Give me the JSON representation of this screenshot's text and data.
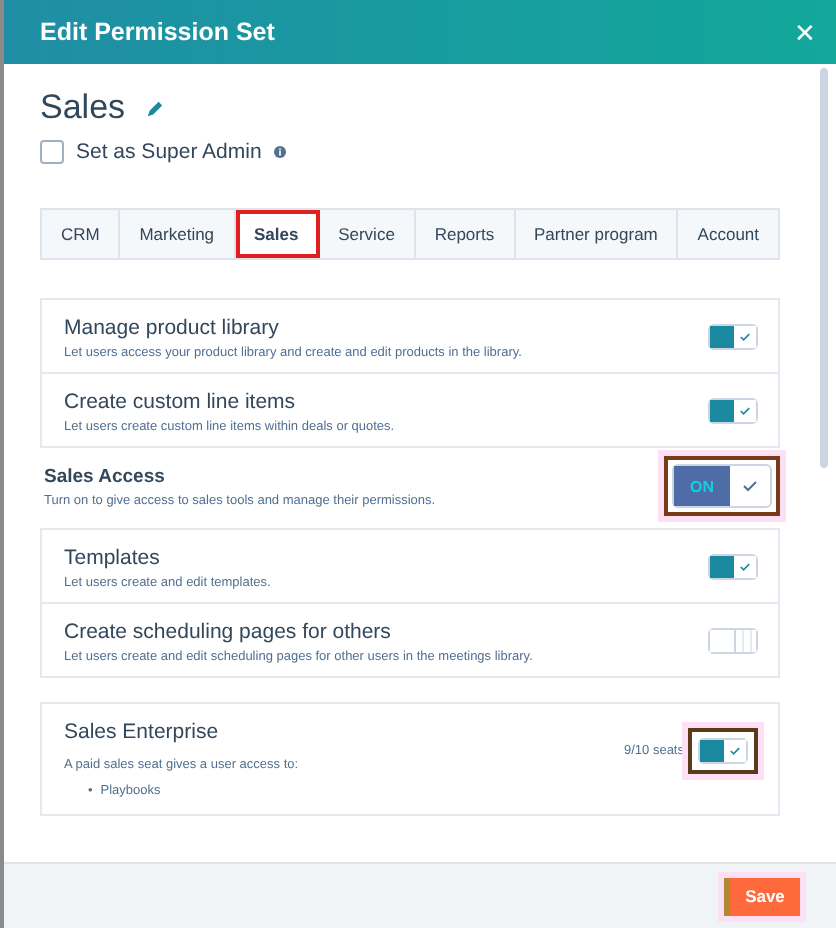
{
  "window": {
    "title": "Edit Permission Set",
    "close": "✕"
  },
  "permission_set": {
    "name": "Sales",
    "super_admin": {
      "label": "Set as Super Admin",
      "checked": false
    }
  },
  "tabs": [
    {
      "label": "CRM",
      "selected": false
    },
    {
      "label": "Marketing",
      "selected": false
    },
    {
      "label": "Sales",
      "selected": true
    },
    {
      "label": "Service",
      "selected": false
    },
    {
      "label": "Reports",
      "selected": false
    },
    {
      "label": "Partner program",
      "selected": false
    },
    {
      "label": "Account",
      "selected": false
    }
  ],
  "product_permissions": [
    {
      "title": "Manage product library",
      "description": "Let users access your product library and create and edit products in the library.",
      "on": true
    },
    {
      "title": "Create custom line items",
      "description": "Let users create custom line items within deals or quotes.",
      "on": true
    }
  ],
  "sales_access": {
    "title": "Sales Access",
    "description": "Turn on to give access to sales tools and manage their permissions.",
    "toggle_label": "ON",
    "on": true,
    "highlighted": true
  },
  "sales_permissions": [
    {
      "title": "Templates",
      "description": "Let users create and edit templates.",
      "on": true
    },
    {
      "title": "Create scheduling pages for others",
      "description": "Let users create and edit scheduling pages for other users in the meetings library.",
      "on": false
    }
  ],
  "seat": {
    "title": "Sales Enterprise",
    "description": "A paid sales seat gives a user access to:",
    "features": [
      {
        "bullet": "•",
        "text": "Playbooks"
      }
    ],
    "seats": "9/10 seats",
    "on": true,
    "highlighted": true
  },
  "footer": {
    "save": "Save",
    "highlighted": true
  }
}
